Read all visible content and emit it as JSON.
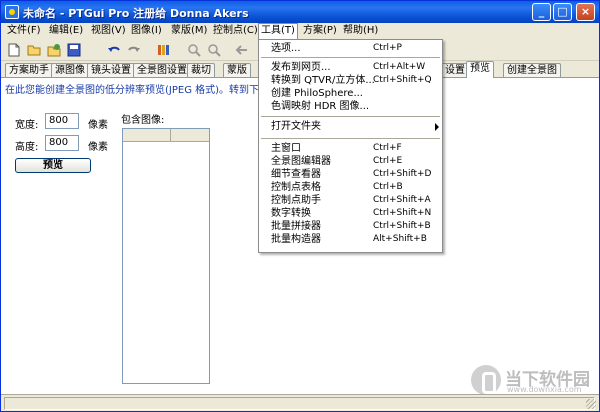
{
  "window": {
    "title": "未命名 - PTGui Pro 注册给 Donna Akers"
  },
  "menubar": {
    "items": [
      {
        "label": "文件(F)"
      },
      {
        "label": "编辑(E)"
      },
      {
        "label": "视图(V)"
      },
      {
        "label": "图像(I)"
      },
      {
        "label": "蒙版(M)"
      },
      {
        "label": "控制点(C)"
      },
      {
        "label": "工具(T)"
      },
      {
        "label": "方案(P)"
      },
      {
        "label": "帮助(H)"
      }
    ]
  },
  "toolbar": {
    "icons": [
      "new-file-icon",
      "open-folder-icon",
      "open-recent-icon",
      "save-icon",
      "undo-icon",
      "redo-icon",
      "align-icon",
      "zoom-in-icon",
      "zoom-out-icon",
      "back-arrow-icon"
    ]
  },
  "tabs": {
    "items": [
      {
        "label": "方案助手"
      },
      {
        "label": "源图像"
      },
      {
        "label": "镜头设置"
      },
      {
        "label": "全景图设置"
      },
      {
        "label": "裁切"
      },
      {
        "label": "蒙版"
      },
      {
        "label": "设置"
      },
      {
        "label": "预览"
      },
      {
        "label": "创建全景图"
      }
    ],
    "active": "预览"
  },
  "preview_panel": {
    "instruction": "在此您能创建全景图的低分辨率预览(JPEG 格式)。转到下一页",
    "width_label": "宽度:",
    "width_value": "800",
    "width_unit": "像素",
    "height_label": "高度:",
    "height_value": "800",
    "height_unit": "像素",
    "preview_button": "预览",
    "include_images_label": "包含图像:"
  },
  "tools_menu": {
    "items": [
      {
        "label": "选项...",
        "shortcut": "Ctrl+P"
      },
      {
        "label": "发布到网页...",
        "shortcut": "Ctrl+Alt+W"
      },
      {
        "label": "转换到 QTVR/立方体...",
        "shortcut": "Ctrl+Shift+Q"
      },
      {
        "label": "创建 PhiloSphere...",
        "shortcut": ""
      },
      {
        "label": "色调映射 HDR 图像...",
        "shortcut": ""
      },
      {
        "label": "打开文件夹",
        "shortcut": ""
      },
      {
        "label": "主窗口",
        "shortcut": "Ctrl+F"
      },
      {
        "label": "全景图编辑器",
        "shortcut": "Ctrl+E"
      },
      {
        "label": "细节查看器",
        "shortcut": "Ctrl+Shift+D"
      },
      {
        "label": "控制点表格",
        "shortcut": "Ctrl+B"
      },
      {
        "label": "控制点助手",
        "shortcut": "Ctrl+Shift+A"
      },
      {
        "label": "数字转换",
        "shortcut": "Ctrl+Shift+N"
      },
      {
        "label": "批量拼接器",
        "shortcut": "Ctrl+Shift+B"
      },
      {
        "label": "批量构造器",
        "shortcut": "Alt+Shift+B"
      }
    ]
  },
  "watermark": {
    "text": "当下软件园",
    "sub": "www.downxia.com"
  },
  "colors": {
    "title_bar": "#0a54d6",
    "instruction_text": "#1a3ca8",
    "window_bg": "#ece9d8"
  }
}
